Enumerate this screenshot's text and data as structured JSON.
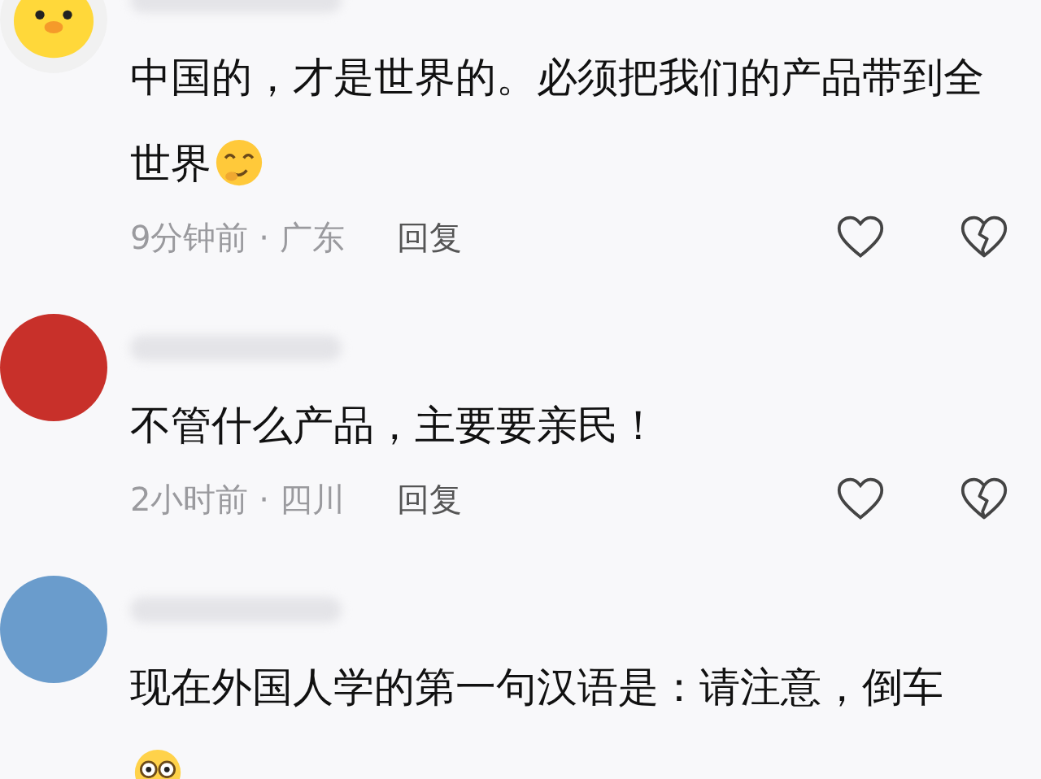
{
  "comments": [
    {
      "avatar": {
        "kind": "chick"
      },
      "text": "中国的，才是世界的。必须把我们的产品带到全世界",
      "emoji": {
        "kind": "smirk"
      },
      "meta": {
        "info": "9分钟前 · 广东",
        "reply": "回复"
      }
    },
    {
      "avatar": {
        "kind": "photo",
        "color": "#c8302a"
      },
      "text": "不管什么产品，主要要亲民！",
      "meta": {
        "info": "2小时前 · 四川",
        "reply": "回复"
      }
    },
    {
      "avatar": {
        "kind": "photo",
        "color": "#6a9ccc"
      },
      "text": "现在外国人学的第一句汉语是：请注意，倒车",
      "emoji": {
        "kind": "wide-eyes"
      }
    }
  ]
}
